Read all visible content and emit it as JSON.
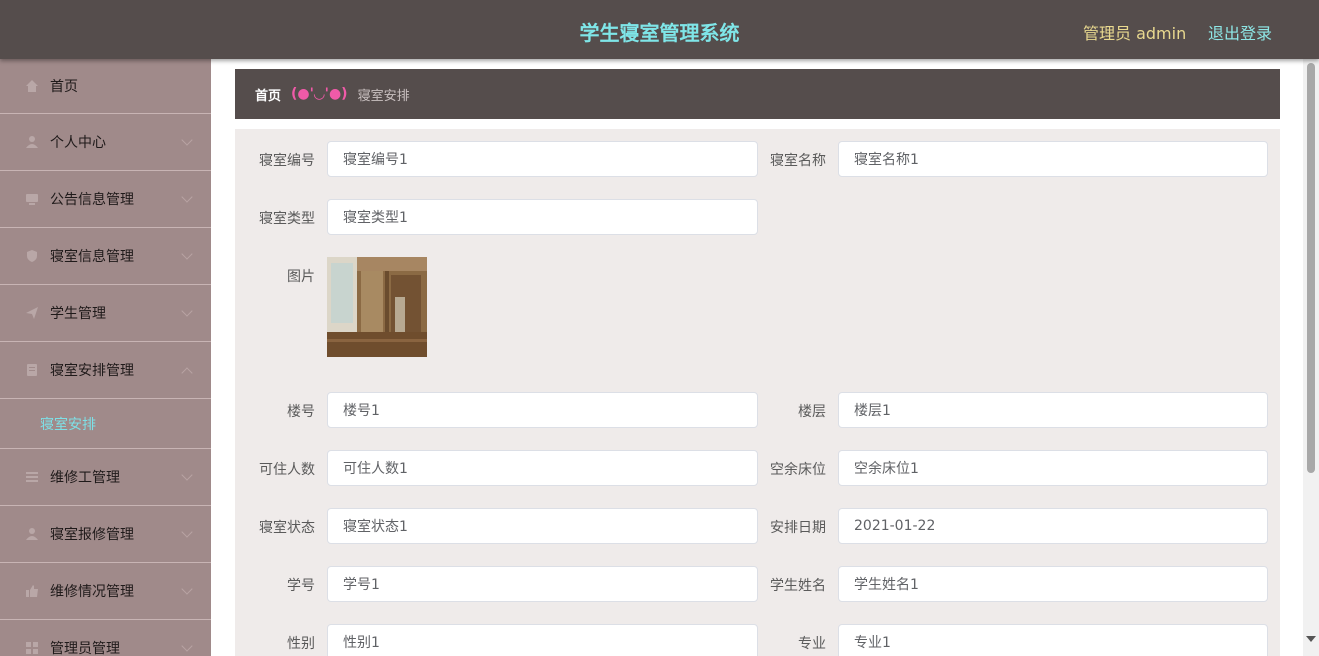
{
  "header": {
    "title": "学生寝室管理系统",
    "admin_label": "管理员 admin",
    "logout_label": "退出登录"
  },
  "sidebar": {
    "items": [
      {
        "label": "首页",
        "icon": "home-icon"
      },
      {
        "label": "个人中心",
        "icon": "user-icon"
      },
      {
        "label": "公告信息管理",
        "icon": "monitor-icon"
      },
      {
        "label": "寝室信息管理",
        "icon": "shield-icon"
      },
      {
        "label": "学生管理",
        "icon": "send-icon"
      },
      {
        "label": "寝室安排管理",
        "icon": "document-icon"
      },
      {
        "label": "维修工管理",
        "icon": "list-icon"
      },
      {
        "label": "寝室报修管理",
        "icon": "person-icon"
      },
      {
        "label": "维修情况管理",
        "icon": "thumb-icon"
      },
      {
        "label": "管理员管理",
        "icon": "grid-icon"
      }
    ],
    "submenu": {
      "label": "寝室安排"
    }
  },
  "breadcrumb": {
    "home": "首页",
    "separator": "(●'◡'●)",
    "current": "寝室安排"
  },
  "form": {
    "dorm_no": {
      "label": "寝室编号",
      "value": "寝室编号1"
    },
    "dorm_name": {
      "label": "寝室名称",
      "value": "寝室名称1"
    },
    "dorm_type": {
      "label": "寝室类型",
      "value": "寝室类型1"
    },
    "image": {
      "label": "图片"
    },
    "building": {
      "label": "楼号",
      "value": "楼号1"
    },
    "floor": {
      "label": "楼层",
      "value": "楼层1"
    },
    "capacity": {
      "label": "可住人数",
      "value": "可住人数1"
    },
    "free_beds": {
      "label": "空余床位",
      "value": "空余床位1"
    },
    "status": {
      "label": "寝室状态",
      "value": "寝室状态1"
    },
    "arrange_date": {
      "label": "安排日期",
      "value": "2021-01-22"
    },
    "student_no": {
      "label": "学号",
      "value": "学号1"
    },
    "student_name": {
      "label": "学生姓名",
      "value": "学生姓名1"
    },
    "gender": {
      "label": "性别",
      "value": "性别1"
    },
    "major": {
      "label": "专业",
      "value": "专业1"
    }
  }
}
